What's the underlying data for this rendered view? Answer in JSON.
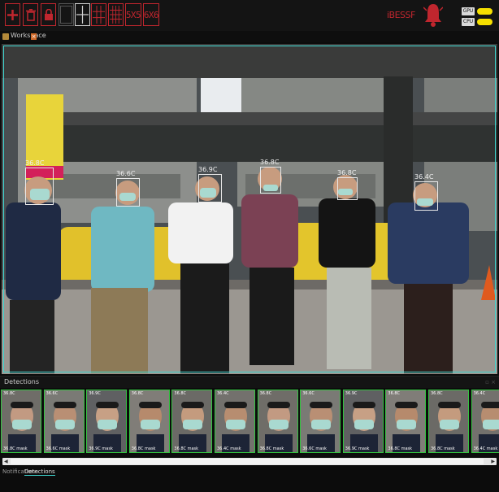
{
  "toolbar": {
    "buttons": [
      {
        "icon": "plus-icon"
      },
      {
        "icon": "trash-icon"
      },
      {
        "icon": "lock-icon"
      },
      {
        "icon": "layout-1x1-icon"
      },
      {
        "icon": "layout-2x2-icon"
      },
      {
        "icon": "layout-3x3-icon"
      },
      {
        "icon": "layout-4x4-icon"
      }
    ],
    "layout_5x5": "5X5",
    "layout_6x6": "6X6",
    "alert_label": "iBESSF",
    "status": [
      {
        "label": "GPU",
        "color": "#f6e000"
      },
      {
        "label": "CPU",
        "color": "#f6e000"
      }
    ],
    "accent": "#c0262e"
  },
  "workspace": {
    "tab_label": "Workspace"
  },
  "camera": {
    "faces": [
      {
        "temp": "36.8C"
      },
      {
        "temp": "36.6C"
      },
      {
        "temp": "36.9C"
      },
      {
        "temp": "36.8C"
      },
      {
        "temp": "36.8C"
      },
      {
        "temp": "36.4C"
      }
    ],
    "border_color": "#3fd6d0"
  },
  "detections": {
    "title": "Detections",
    "thumbnails": [
      {
        "top": "36.8C",
        "bottom": "36.8C mask"
      },
      {
        "top": "36.6C",
        "bottom": "36.6C mask"
      },
      {
        "top": "36.9C",
        "bottom": "36.9C mask"
      },
      {
        "top": "36.8C",
        "bottom": "36.8C mask"
      },
      {
        "top": "36.8C",
        "bottom": "36.8C mask"
      },
      {
        "top": "36.4C",
        "bottom": "36.4C mask"
      },
      {
        "top": "36.8C",
        "bottom": "36.8C mask"
      },
      {
        "top": "36.6C",
        "bottom": "36.6C mask"
      },
      {
        "top": "36.9C",
        "bottom": "36.9C mask"
      },
      {
        "top": "36.8C",
        "bottom": "36.8C mask"
      },
      {
        "top": "36.8C",
        "bottom": "36.8C mask"
      },
      {
        "top": "36.4C",
        "bottom": "36.4C mask"
      }
    ]
  },
  "bottom_tabs": [
    "Notifications",
    "Detections"
  ]
}
